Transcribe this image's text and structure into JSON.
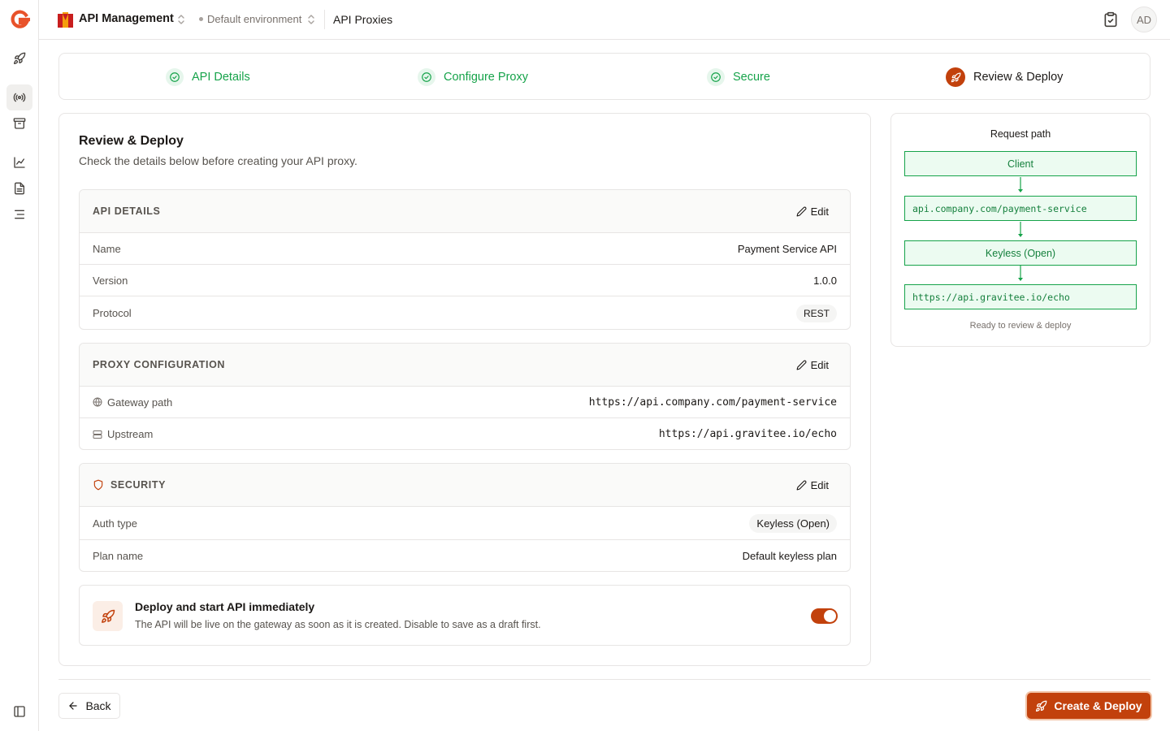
{
  "app": {
    "name": "API Management",
    "environment": "Default environment",
    "breadcrumb": "API Proxies",
    "avatar_initials": "AD",
    "brand_color": "#c2410c",
    "success_color": "#16a34a"
  },
  "rail": {
    "icons": [
      "gravitee-logo-icon",
      "rocket-icon",
      "broadcast-icon",
      "archive-icon",
      "chart-line-icon",
      "document-icon",
      "list-icon",
      "sidebar-toggle-icon"
    ]
  },
  "stepper": {
    "steps": [
      {
        "label": "API Details",
        "state": "done"
      },
      {
        "label": "Configure Proxy",
        "state": "done"
      },
      {
        "label": "Secure",
        "state": "done"
      },
      {
        "label": "Review & Deploy",
        "state": "current"
      }
    ]
  },
  "review": {
    "title": "Review & Deploy",
    "subtitle": "Check the details below before creating your API proxy.",
    "edit_label": "Edit",
    "api_details": {
      "heading": "API DETAILS",
      "rows": [
        {
          "key": "Name",
          "value": "Payment Service API"
        },
        {
          "key": "Version",
          "value": "1.0.0"
        },
        {
          "key": "Protocol",
          "value": "REST"
        }
      ]
    },
    "proxy": {
      "heading": "PROXY CONFIGURATION",
      "rows": [
        {
          "key": "Gateway path",
          "value": "https://api.company.com/payment-service",
          "icon": "globe-icon"
        },
        {
          "key": "Upstream",
          "value": "https://api.gravitee.io/echo",
          "icon": "server-icon"
        }
      ]
    },
    "security": {
      "heading": "SECURITY",
      "rows": [
        {
          "key": "Auth type",
          "value": "Keyless (Open)"
        },
        {
          "key": "Plan name",
          "value": "Default keyless plan"
        }
      ]
    },
    "deploy": {
      "title": "Deploy and start API immediately",
      "description": "The API will be live on the gateway as soon as it is created. Disable to save as a draft first.",
      "enabled": true
    }
  },
  "request_path": {
    "title": "Request path",
    "nodes": [
      "Client",
      "api.company.com/payment-service",
      "Keyless (Open)",
      "https://api.gravitee.io/echo"
    ],
    "footer": "Ready to review & deploy"
  },
  "footer": {
    "back_label": "Back",
    "deploy_label": "Create & Deploy"
  }
}
